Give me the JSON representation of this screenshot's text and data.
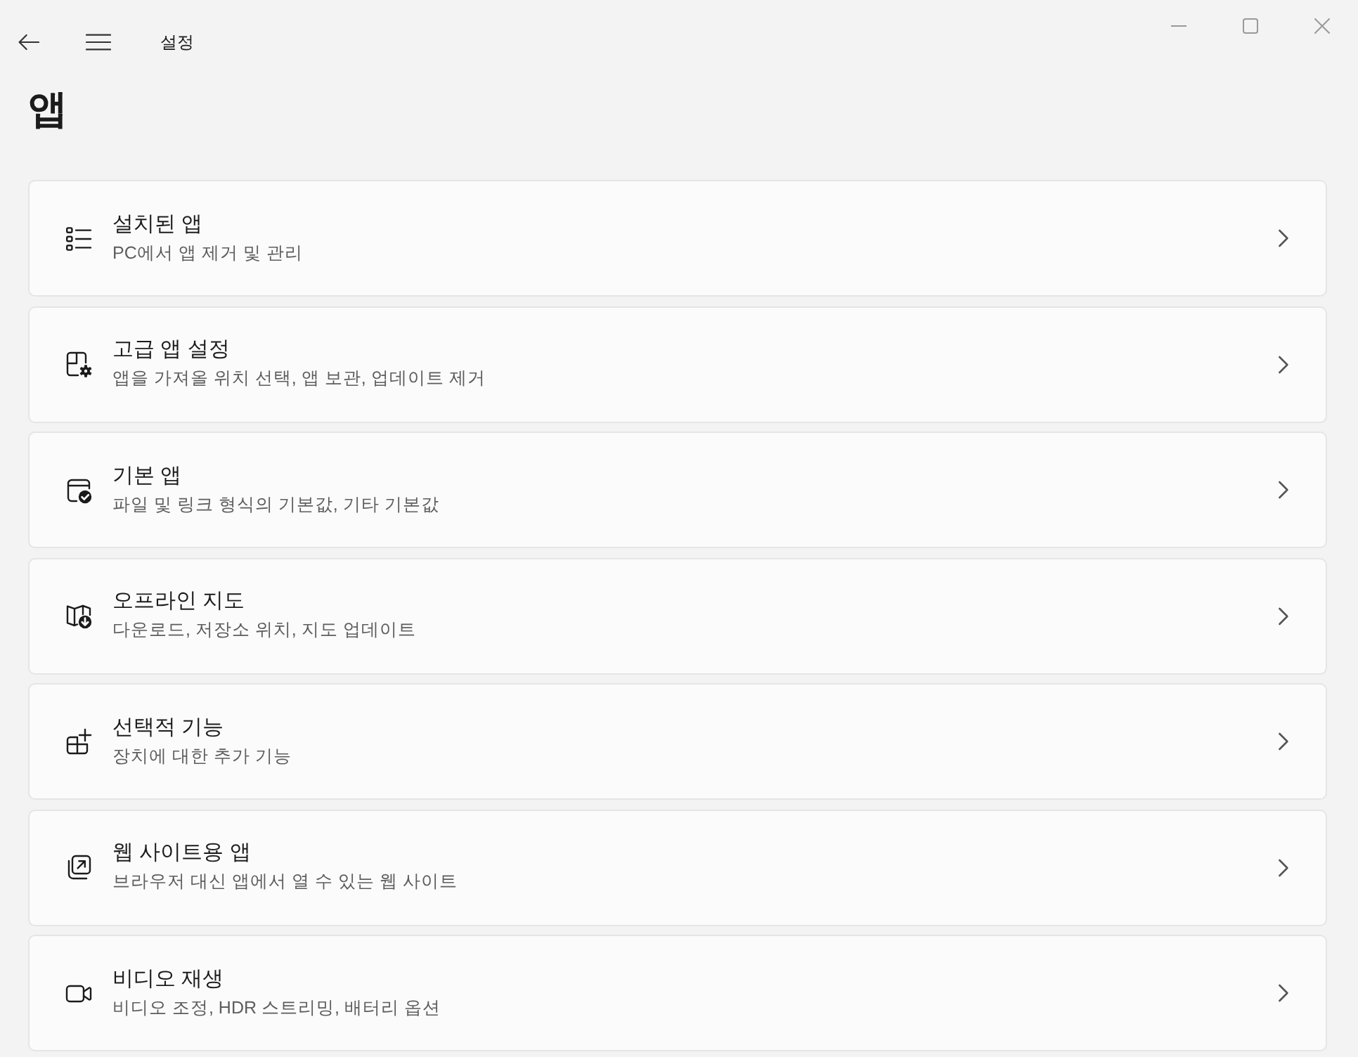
{
  "window": {
    "title": "설정"
  },
  "page": {
    "title": "앱"
  },
  "items": [
    {
      "title": "설치된 앱",
      "description": "PC에서 앱 제거 및 관리"
    },
    {
      "title": "고급 앱 설정",
      "description": "앱을 가져올 위치 선택, 앱 보관, 업데이트 제거"
    },
    {
      "title": "기본 앱",
      "description": "파일 및 링크 형식의 기본값, 기타 기본값"
    },
    {
      "title": "오프라인 지도",
      "description": "다운로드, 저장소 위치, 지도 업데이트"
    },
    {
      "title": "선택적 기능",
      "description": "장치에 대한 추가 기능"
    },
    {
      "title": "웹 사이트용 앱",
      "description": "브라우저 대신 앱에서 열 수 있는 웹 사이트"
    },
    {
      "title": "비디오 재생",
      "description": "비디오 조정, HDR 스트리밍, 배터리 옵션"
    }
  ]
}
